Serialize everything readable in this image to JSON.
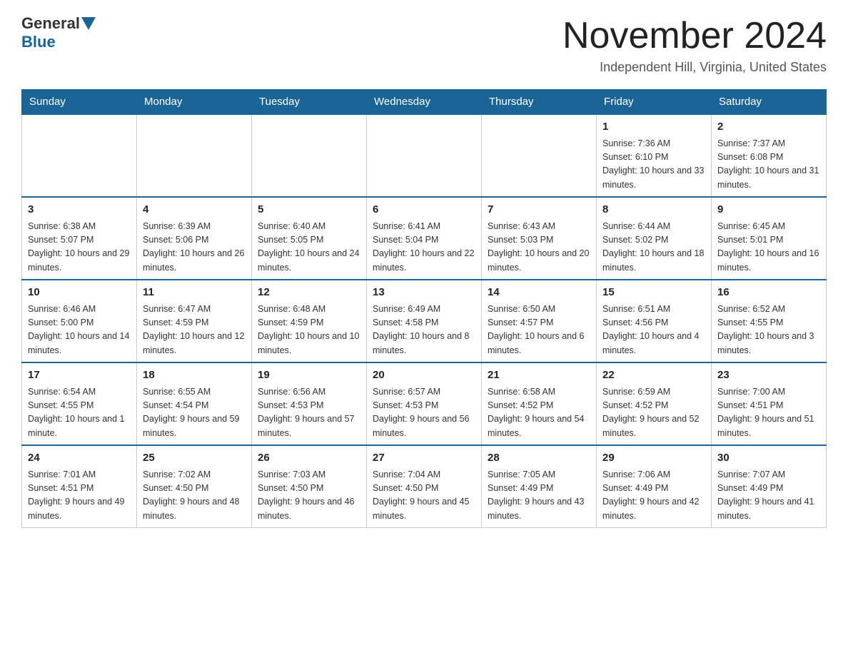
{
  "header": {
    "logo": {
      "general": "General",
      "blue": "Blue"
    },
    "title": "November 2024",
    "location": "Independent Hill, Virginia, United States"
  },
  "calendar": {
    "days_of_week": [
      "Sunday",
      "Monday",
      "Tuesday",
      "Wednesday",
      "Thursday",
      "Friday",
      "Saturday"
    ],
    "weeks": [
      [
        {
          "day": "",
          "sunrise": "",
          "sunset": "",
          "daylight": ""
        },
        {
          "day": "",
          "sunrise": "",
          "sunset": "",
          "daylight": ""
        },
        {
          "day": "",
          "sunrise": "",
          "sunset": "",
          "daylight": ""
        },
        {
          "day": "",
          "sunrise": "",
          "sunset": "",
          "daylight": ""
        },
        {
          "day": "",
          "sunrise": "",
          "sunset": "",
          "daylight": ""
        },
        {
          "day": "1",
          "sunrise": "Sunrise: 7:36 AM",
          "sunset": "Sunset: 6:10 PM",
          "daylight": "Daylight: 10 hours and 33 minutes."
        },
        {
          "day": "2",
          "sunrise": "Sunrise: 7:37 AM",
          "sunset": "Sunset: 6:08 PM",
          "daylight": "Daylight: 10 hours and 31 minutes."
        }
      ],
      [
        {
          "day": "3",
          "sunrise": "Sunrise: 6:38 AM",
          "sunset": "Sunset: 5:07 PM",
          "daylight": "Daylight: 10 hours and 29 minutes."
        },
        {
          "day": "4",
          "sunrise": "Sunrise: 6:39 AM",
          "sunset": "Sunset: 5:06 PM",
          "daylight": "Daylight: 10 hours and 26 minutes."
        },
        {
          "day": "5",
          "sunrise": "Sunrise: 6:40 AM",
          "sunset": "Sunset: 5:05 PM",
          "daylight": "Daylight: 10 hours and 24 minutes."
        },
        {
          "day": "6",
          "sunrise": "Sunrise: 6:41 AM",
          "sunset": "Sunset: 5:04 PM",
          "daylight": "Daylight: 10 hours and 22 minutes."
        },
        {
          "day": "7",
          "sunrise": "Sunrise: 6:43 AM",
          "sunset": "Sunset: 5:03 PM",
          "daylight": "Daylight: 10 hours and 20 minutes."
        },
        {
          "day": "8",
          "sunrise": "Sunrise: 6:44 AM",
          "sunset": "Sunset: 5:02 PM",
          "daylight": "Daylight: 10 hours and 18 minutes."
        },
        {
          "day": "9",
          "sunrise": "Sunrise: 6:45 AM",
          "sunset": "Sunset: 5:01 PM",
          "daylight": "Daylight: 10 hours and 16 minutes."
        }
      ],
      [
        {
          "day": "10",
          "sunrise": "Sunrise: 6:46 AM",
          "sunset": "Sunset: 5:00 PM",
          "daylight": "Daylight: 10 hours and 14 minutes."
        },
        {
          "day": "11",
          "sunrise": "Sunrise: 6:47 AM",
          "sunset": "Sunset: 4:59 PM",
          "daylight": "Daylight: 10 hours and 12 minutes."
        },
        {
          "day": "12",
          "sunrise": "Sunrise: 6:48 AM",
          "sunset": "Sunset: 4:59 PM",
          "daylight": "Daylight: 10 hours and 10 minutes."
        },
        {
          "day": "13",
          "sunrise": "Sunrise: 6:49 AM",
          "sunset": "Sunset: 4:58 PM",
          "daylight": "Daylight: 10 hours and 8 minutes."
        },
        {
          "day": "14",
          "sunrise": "Sunrise: 6:50 AM",
          "sunset": "Sunset: 4:57 PM",
          "daylight": "Daylight: 10 hours and 6 minutes."
        },
        {
          "day": "15",
          "sunrise": "Sunrise: 6:51 AM",
          "sunset": "Sunset: 4:56 PM",
          "daylight": "Daylight: 10 hours and 4 minutes."
        },
        {
          "day": "16",
          "sunrise": "Sunrise: 6:52 AM",
          "sunset": "Sunset: 4:55 PM",
          "daylight": "Daylight: 10 hours and 3 minutes."
        }
      ],
      [
        {
          "day": "17",
          "sunrise": "Sunrise: 6:54 AM",
          "sunset": "Sunset: 4:55 PM",
          "daylight": "Daylight: 10 hours and 1 minute."
        },
        {
          "day": "18",
          "sunrise": "Sunrise: 6:55 AM",
          "sunset": "Sunset: 4:54 PM",
          "daylight": "Daylight: 9 hours and 59 minutes."
        },
        {
          "day": "19",
          "sunrise": "Sunrise: 6:56 AM",
          "sunset": "Sunset: 4:53 PM",
          "daylight": "Daylight: 9 hours and 57 minutes."
        },
        {
          "day": "20",
          "sunrise": "Sunrise: 6:57 AM",
          "sunset": "Sunset: 4:53 PM",
          "daylight": "Daylight: 9 hours and 56 minutes."
        },
        {
          "day": "21",
          "sunrise": "Sunrise: 6:58 AM",
          "sunset": "Sunset: 4:52 PM",
          "daylight": "Daylight: 9 hours and 54 minutes."
        },
        {
          "day": "22",
          "sunrise": "Sunrise: 6:59 AM",
          "sunset": "Sunset: 4:52 PM",
          "daylight": "Daylight: 9 hours and 52 minutes."
        },
        {
          "day": "23",
          "sunrise": "Sunrise: 7:00 AM",
          "sunset": "Sunset: 4:51 PM",
          "daylight": "Daylight: 9 hours and 51 minutes."
        }
      ],
      [
        {
          "day": "24",
          "sunrise": "Sunrise: 7:01 AM",
          "sunset": "Sunset: 4:51 PM",
          "daylight": "Daylight: 9 hours and 49 minutes."
        },
        {
          "day": "25",
          "sunrise": "Sunrise: 7:02 AM",
          "sunset": "Sunset: 4:50 PM",
          "daylight": "Daylight: 9 hours and 48 minutes."
        },
        {
          "day": "26",
          "sunrise": "Sunrise: 7:03 AM",
          "sunset": "Sunset: 4:50 PM",
          "daylight": "Daylight: 9 hours and 46 minutes."
        },
        {
          "day": "27",
          "sunrise": "Sunrise: 7:04 AM",
          "sunset": "Sunset: 4:50 PM",
          "daylight": "Daylight: 9 hours and 45 minutes."
        },
        {
          "day": "28",
          "sunrise": "Sunrise: 7:05 AM",
          "sunset": "Sunset: 4:49 PM",
          "daylight": "Daylight: 9 hours and 43 minutes."
        },
        {
          "day": "29",
          "sunrise": "Sunrise: 7:06 AM",
          "sunset": "Sunset: 4:49 PM",
          "daylight": "Daylight: 9 hours and 42 minutes."
        },
        {
          "day": "30",
          "sunrise": "Sunrise: 7:07 AM",
          "sunset": "Sunset: 4:49 PM",
          "daylight": "Daylight: 9 hours and 41 minutes."
        }
      ]
    ]
  }
}
